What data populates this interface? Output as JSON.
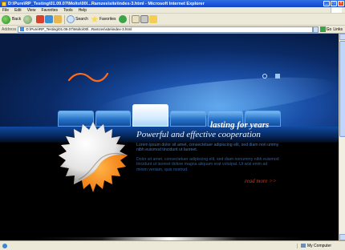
{
  "window": {
    "title": "D:\\Pure\\RP_Testing\\01.09.07\\Molto\\00l...Ramzes\\site\\index-3.html - Microsoft Internet Explorer",
    "controls": [
      "_",
      "□",
      "×"
    ]
  },
  "menu": [
    "File",
    "Edit",
    "View",
    "Favorites",
    "Tools",
    "Help"
  ],
  "toolbar": {
    "back_label": "Back",
    "search_label": "Search",
    "favorites_label": "Favorites"
  },
  "address": {
    "label": "Address",
    "value": "D:\\Pure\\RP_Testing\\01.09.07\\Molto\\00l...Ramzes\\site\\index-3.html",
    "go_label": "Go",
    "links_label": "Links"
  },
  "page": {
    "tagline": "lasting for years",
    "subtitle": "Powerful and effective cooperation",
    "paragraph1": "Lorem ipsum dolor sit amet, consectetuer adipiscing elit, sed diam non ummy nibh euismod tincidunt ut laoreet.",
    "paragraph2": "Dolor sit amet, consectetuer adipiscing elit, sed diam nonummy nibh euismod tincidunt ut laoreet dolore magna aliquam erat volutpat. Ut wisi enim ad minim veniam, quis nostrud.",
    "read_more": "read more >>"
  },
  "status": {
    "zone": "My Computer"
  },
  "colors": {
    "accent_blue": "#1a4fa8",
    "read_more": "#d53a1d"
  }
}
